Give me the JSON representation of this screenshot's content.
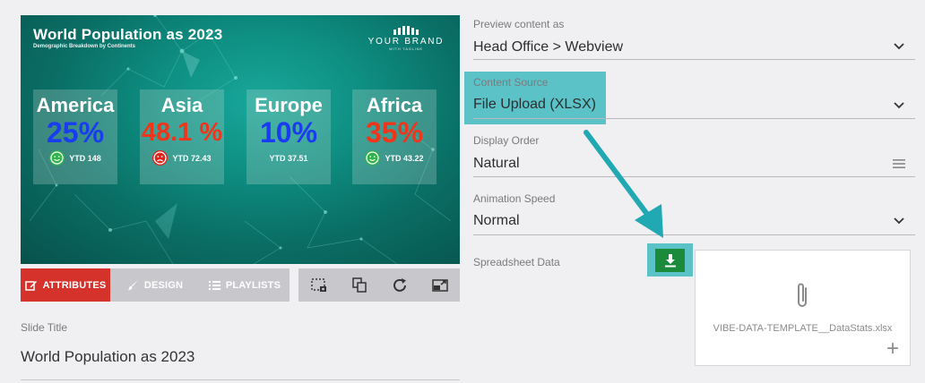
{
  "preview": {
    "title": "World Population as 2023",
    "subtitle": "Demographic Breakdown by Continents",
    "brand_name": "YOUR BRAND",
    "brand_tagline": "WITH TAGLINE",
    "cards": [
      {
        "name": "America",
        "value": "25%",
        "ytd": "YTD 148",
        "mood": "happy",
        "color": "#1a3cf0"
      },
      {
        "name": "Asia",
        "value": "48.1 %",
        "ytd": "YTD 72.43",
        "mood": "sad",
        "color": "#f0361a"
      },
      {
        "name": "Europe",
        "value": "10%",
        "ytd": "YTD 37.51",
        "mood": "none",
        "color": "#1a3cf0"
      },
      {
        "name": "Africa",
        "value": "35%",
        "ytd": "YTD 43.22",
        "mood": "happy",
        "color": "#f0361a"
      }
    ]
  },
  "tabs": {
    "attributes": "ATTRIBUTES",
    "design": "DESIGN",
    "playlists": "PLAYLISTS"
  },
  "tools": [
    "screenshot-icon",
    "copy-icon",
    "refresh-icon",
    "popout-icon"
  ],
  "slide_title": {
    "label": "Slide Title",
    "value": "World Population as 2023"
  },
  "fields": {
    "preview_as": {
      "label": "Preview content as",
      "value": "Head Office > Webview"
    },
    "content_source": {
      "label": "Content Source",
      "value": "File Upload (XLSX)"
    },
    "display_order": {
      "label": "Display Order",
      "value": "Natural"
    },
    "animation_speed": {
      "label": "Animation Speed",
      "value": "Normal"
    },
    "spreadsheet": {
      "label": "Spreadsheet Data",
      "filename": "VIBE-DATA-TEMPLATE__DataStats.xlsx",
      "add": "+"
    }
  },
  "colors": {
    "accent_red": "#d4322a",
    "highlight_teal": "#5bc2c8",
    "download_green": "#1b8a3a",
    "happy_green": "#2fb34a",
    "sad_red": "#e0241c"
  }
}
